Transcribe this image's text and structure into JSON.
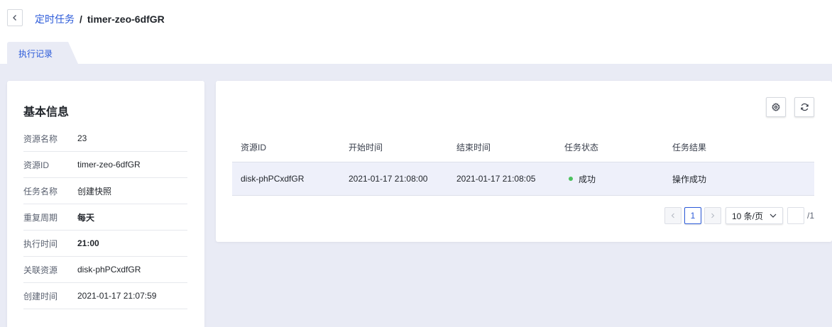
{
  "header": {
    "back_icon": "chevron-left-icon",
    "breadcrumb_parent": "定时任务",
    "breadcrumb_separator": "/",
    "breadcrumb_current": "timer-zeo-6dfGR"
  },
  "tabs": [
    {
      "label": "执行记录",
      "active": true
    }
  ],
  "info": {
    "title": "基本信息",
    "rows": [
      {
        "label": "资源名称",
        "value": "23"
      },
      {
        "label": "资源ID",
        "value": "timer-zeo-6dfGR"
      },
      {
        "label": "任务名称",
        "value": "创建快照"
      },
      {
        "label": "重复周期",
        "value": "每天"
      },
      {
        "label": "执行时间",
        "value": "21:00"
      },
      {
        "label": "关联资源",
        "value": "disk-phPCxdfGR"
      },
      {
        "label": "创建时间",
        "value": "2021-01-17 21:07:59"
      }
    ]
  },
  "toolbar": {
    "settings_icon": "gear-icon",
    "refresh_icon": "refresh-icon"
  },
  "table": {
    "columns": [
      "资源ID",
      "开始时间",
      "结束时间",
      "任务状态",
      "任务结果"
    ],
    "rows": [
      {
        "resource_id": "disk-phPCxdfGR",
        "start_time": "2021-01-17 21:08:00",
        "end_time": "2021-01-17 21:08:05",
        "status": "成功",
        "result": "操作成功"
      }
    ]
  },
  "pagination": {
    "current_page": "1",
    "page_size": "10 条/页",
    "jump_value": "",
    "total_pages": "/1"
  },
  "colors": {
    "accent": "#2b5ad9",
    "background": "#e9ebf5",
    "status_success": "#4cc15e"
  }
}
